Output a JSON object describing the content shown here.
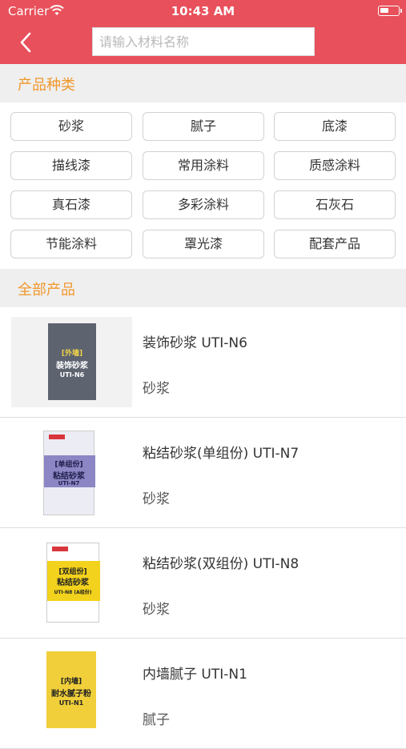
{
  "status_bar": {
    "carrier": "Carrier",
    "time": "10:43 AM"
  },
  "search": {
    "placeholder": "请输入材料名称"
  },
  "categories": {
    "title": "产品种类",
    "items": [
      "砂浆",
      "腻子",
      "底漆",
      "描线漆",
      "常用涂料",
      "质感涂料",
      "真石漆",
      "多彩涂料",
      "石灰石",
      "节能涂料",
      "罩光漆",
      "配套产品"
    ]
  },
  "products": {
    "title": "全部产品",
    "items": [
      {
        "name": "装饰砂浆 UTI-N6",
        "category": "砂浆",
        "bag_line1": "[外墙]",
        "bag_line2": "装饰砂浆",
        "bag_line3": "UTI-N6",
        "bag_color": "#5d6470"
      },
      {
        "name": "粘结砂浆(单组份) UTI-N7",
        "category": "砂浆",
        "bag_line1": "[单组份]",
        "bag_line2": "粘结砂浆",
        "bag_line3": "UTI-N7",
        "bag_color": "#8c86c4"
      },
      {
        "name": "粘结砂浆(双组份) UTI-N8",
        "category": "砂浆",
        "bag_line1": "[双组份]",
        "bag_line2": "粘结砂浆",
        "bag_line3": "UTI-N8 (A组份)",
        "bag_color": "#f2d21c"
      },
      {
        "name": "内墙腻子 UTI-N1",
        "category": "腻子",
        "bag_line1": "[内墙]",
        "bag_line2": "耐水腻子粉",
        "bag_line3": "UTI-N1",
        "bag_color": "#f0cf3a"
      }
    ]
  },
  "colors": {
    "header": "#e8505b",
    "accent": "#f0982d",
    "section_bg": "#efefef"
  }
}
